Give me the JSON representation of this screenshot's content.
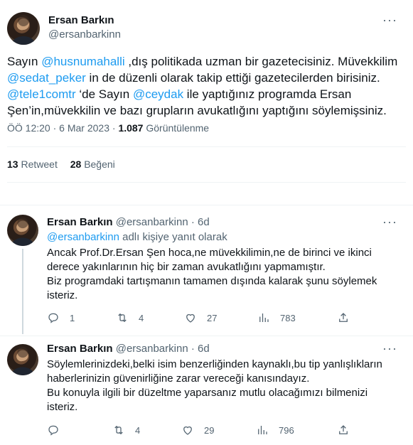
{
  "main_tweet": {
    "display_name": "Ersan Barkın",
    "handle": "@ersanbarkinn",
    "text": {
      "l1_a": "Sayın ",
      "l1_mention": "@husnumahalli",
      "l1_b": " ,dış politikada uzman bir gazetecisiniz. Müvekkilim",
      "l2_mention": "@sedat_peker",
      "l2_b": " in de düzenli olarak takip ettiği gazetecilerden birisiniz.",
      "l3_mention1": "@tele1comtr",
      "l3_b": " ‘de Sayın ",
      "l3_mention2": "@ceydak",
      "l3_c": " ile yaptığınız programda Ersan",
      "l4": "Şen’in,müvekkilin ve bazı grupların avukatlığını yaptığını söylemişsiniz."
    },
    "meta": {
      "time": "ÖÖ 12:20",
      "sep": "·",
      "date": "6 Mar 2023",
      "views_count": "1.087",
      "views_label": "Görüntülenme"
    },
    "stats": {
      "retweets_count": "13",
      "retweets_label": "Retweet",
      "likes_count": "28",
      "likes_label": "Beğeni"
    }
  },
  "replies": [
    {
      "display_name": "Ersan Barkın",
      "handle": "@ersanbarkinn",
      "sep": "·",
      "age": "6d",
      "reply_to_mention": "@ersanbarkinn",
      "reply_to_suffix": " adlı kişiye yanıt olarak",
      "lines": [
        "Ancak Prof.Dr.Ersan Şen hoca,ne müvekkilimin,ne de birinci ve ikinci",
        "derece yakınlarının hiç bir zaman avukatlığını yapmamıştır.",
        "Biz programdaki tartışmanın tamamen dışında kalarak şunu söylemek",
        "isteriz."
      ],
      "actions": {
        "replies": "1",
        "retweets": "4",
        "likes": "27",
        "views": "783"
      }
    },
    {
      "display_name": "Ersan Barkın",
      "handle": "@ersanbarkinn",
      "sep": "·",
      "age": "6d",
      "lines": [
        "Söylemlerinizdeki,belki isim benzerliğinden kaynaklı,bu tip yanlışlıkların",
        "haberlerinizin güvenirliğine zarar vereceği kanısındayız.",
        "Bu konuyla ilgili bir düzeltme yaparsanız mutlu olacağımızı bilmenizi",
        "isteriz."
      ],
      "actions": {
        "replies": "",
        "retweets": "4",
        "likes": "29",
        "views": "796"
      }
    }
  ],
  "icons": {
    "more": "more-horizontal-icon",
    "reply": "reply-icon",
    "retweet": "retweet-icon",
    "like": "heart-icon",
    "views": "views-bar-chart-icon",
    "share": "share-icon"
  },
  "colors": {
    "link": "#1d9bf0",
    "muted": "#536471",
    "text": "#0f1419",
    "divider": "#eff3f4"
  }
}
